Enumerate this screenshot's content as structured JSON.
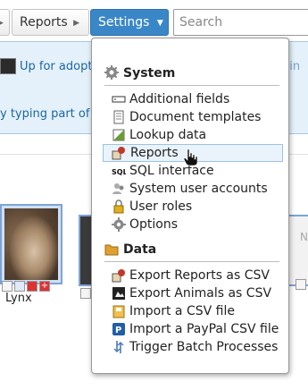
{
  "nav": {
    "prev_label": "",
    "reports_label": "Reports",
    "settings_label": "Settings",
    "search_placeholder": "Search"
  },
  "background": {
    "adopt_link": "Up for adopt",
    "adopt_right": "nin",
    "hint_text": "y typing part of n",
    "hint_right": "",
    "lynx_name": "Lynx",
    "right_card_letter": "N"
  },
  "menu": {
    "system_heading": "System",
    "data_heading": "Data",
    "system_items": [
      {
        "label": "Additional fields",
        "icon": "additional-fields-icon"
      },
      {
        "label": "Document templates",
        "icon": "document-templates-icon"
      },
      {
        "label": "Lookup data",
        "icon": "lookup-data-icon"
      },
      {
        "label": "Reports",
        "icon": "reports-icon"
      },
      {
        "label": "SQL interface",
        "icon": "sql-icon"
      },
      {
        "label": "System user accounts",
        "icon": "users-icon"
      },
      {
        "label": "User roles",
        "icon": "lock-icon"
      },
      {
        "label": "Options",
        "icon": "gear-icon"
      }
    ],
    "data_items": [
      {
        "label": "Export Reports as CSV",
        "icon": "export-reports-icon"
      },
      {
        "label": "Export Animals as CSV",
        "icon": "export-animals-icon"
      },
      {
        "label": "Import a CSV file",
        "icon": "import-csv-icon"
      },
      {
        "label": "Import a PayPal CSV file",
        "icon": "paypal-icon"
      },
      {
        "label": "Trigger Batch Processes",
        "icon": "batch-icon"
      }
    ],
    "hovered_item": "Reports"
  },
  "colors": {
    "settings_active": "#3a87c8",
    "link_blue": "#1b65a5",
    "hover_bg": "#eaf3fb"
  }
}
